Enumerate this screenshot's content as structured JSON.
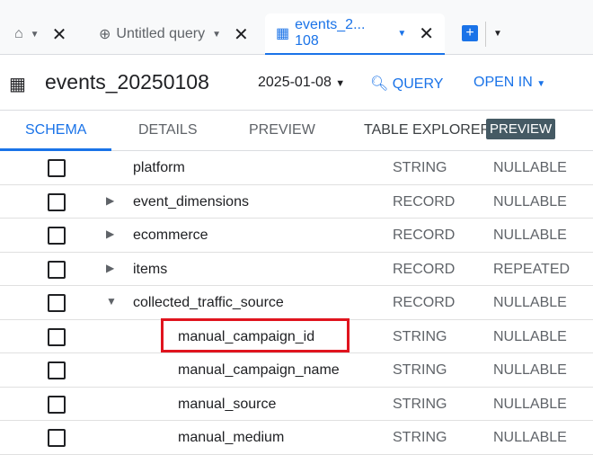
{
  "tabs": [
    {
      "label": "",
      "icon": "home-icon"
    },
    {
      "label": "Untitled query",
      "icon": "query-icon"
    },
    {
      "label": "events_2... 108",
      "icon": "table-icon",
      "active": true
    }
  ],
  "header": {
    "title": "events_20250108",
    "date": "2025-01-08",
    "query": "QUERY",
    "open_in": "OPEN IN"
  },
  "subtabs": [
    "SCHEMA",
    "DETAILS",
    "PREVIEW",
    "TABLE EXPLORER"
  ],
  "badge": "PREVIEW",
  "rows": [
    {
      "name": "platform",
      "type": "STRING",
      "mode": "NULLABLE",
      "level": 0,
      "expander": ""
    },
    {
      "name": "event_dimensions",
      "type": "RECORD",
      "mode": "NULLABLE",
      "level": 0,
      "expander": "▶"
    },
    {
      "name": "ecommerce",
      "type": "RECORD",
      "mode": "NULLABLE",
      "level": 0,
      "expander": "▶"
    },
    {
      "name": "items",
      "type": "RECORD",
      "mode": "REPEATED",
      "level": 0,
      "expander": "▶"
    },
    {
      "name": "collected_traffic_source",
      "type": "RECORD",
      "mode": "NULLABLE",
      "level": 0,
      "expander": "▼"
    },
    {
      "name": "manual_campaign_id",
      "type": "STRING",
      "mode": "NULLABLE",
      "level": 1,
      "expander": "",
      "highlighted": true
    },
    {
      "name": "manual_campaign_name",
      "type": "STRING",
      "mode": "NULLABLE",
      "level": 1,
      "expander": ""
    },
    {
      "name": "manual_source",
      "type": "STRING",
      "mode": "NULLABLE",
      "level": 1,
      "expander": ""
    },
    {
      "name": "manual_medium",
      "type": "STRING",
      "mode": "NULLABLE",
      "level": 1,
      "expander": ""
    }
  ],
  "colors": {
    "accent": "#1a73e8",
    "highlight": "#e0141e",
    "badge": "#455a64"
  }
}
